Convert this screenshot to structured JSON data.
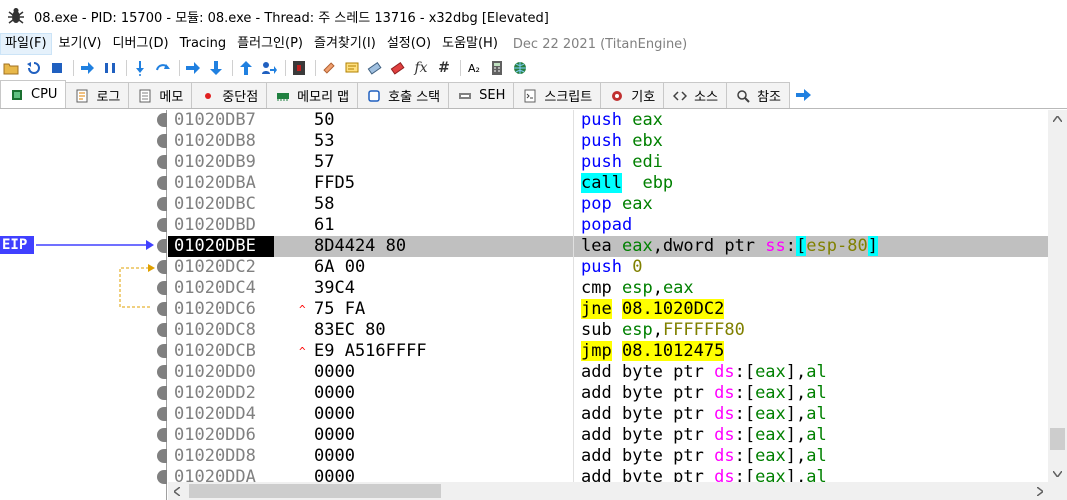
{
  "window": {
    "title": "08.exe - PID: 15700 - 모듈: 08.exe - Thread: 주 스레드 13716 - x32dbg [Elevated]"
  },
  "menu": {
    "items": [
      "파일(F)",
      "보기(V)",
      "디버그(D)",
      "Tracing",
      "플러그인(P)",
      "즐겨찾기(I)",
      "설정(O)",
      "도움말(H)"
    ],
    "date": "Dec 22 2021 (TitanEngine)"
  },
  "toolbar": {
    "icons": [
      "open-icon",
      "restart-icon",
      "stop-icon",
      "run-icon",
      "pause-icon",
      "step-into-icon",
      "step-over-icon",
      "trace-into-icon",
      "trace-over-icon",
      "execute-till-return-icon",
      "run-to-user-code-icon",
      "scylla-icon",
      "patch-icon",
      "comments-icon",
      "labels-icon",
      "bookmarks-icon",
      "functions-icon",
      "variables-icon",
      "strings-icon",
      "calculator-icon",
      "settings-icon"
    ],
    "fx_label": "fx",
    "hash_label": "#",
    "az_label": "A₂"
  },
  "tabs": [
    {
      "label": "CPU",
      "icon": "cpu-icon",
      "selected": true
    },
    {
      "label": "로그",
      "icon": "log-icon"
    },
    {
      "label": "메모",
      "icon": "notes-icon"
    },
    {
      "label": "중단점",
      "icon": "breakpoint-icon"
    },
    {
      "label": "메모리 맵",
      "icon": "memory-map-icon"
    },
    {
      "label": "호출 스택",
      "icon": "call-stack-icon"
    },
    {
      "label": "SEH",
      "icon": "seh-icon"
    },
    {
      "label": "스크립트",
      "icon": "script-icon"
    },
    {
      "label": "기호",
      "icon": "symbols-icon"
    },
    {
      "label": "소스",
      "icon": "source-icon"
    },
    {
      "label": "참조",
      "icon": "references-icon"
    }
  ],
  "eip_label": "EIP",
  "disasm": [
    {
      "addr": "01020DB7",
      "bytes": "50",
      "mnemonic": "push",
      "mtype": "push",
      "ops": [
        {
          "t": "eax",
          "c": "reg"
        }
      ]
    },
    {
      "addr": "01020DB8",
      "bytes": "53",
      "mnemonic": "push",
      "mtype": "push",
      "ops": [
        {
          "t": "ebx",
          "c": "reg"
        }
      ]
    },
    {
      "addr": "01020DB9",
      "bytes": "57",
      "mnemonic": "push",
      "mtype": "push",
      "ops": [
        {
          "t": "edi",
          "c": "reg"
        }
      ]
    },
    {
      "addr": "01020DBA",
      "bytes": "FFD5",
      "mnemonic": "call",
      "mtype": "call",
      "ops": [
        {
          "t": " ",
          "c": "plain"
        },
        {
          "t": "ebp",
          "c": "reg"
        }
      ]
    },
    {
      "addr": "01020DBC",
      "bytes": "58",
      "mnemonic": "pop",
      "mtype": "push",
      "ops": [
        {
          "t": "eax",
          "c": "reg"
        }
      ]
    },
    {
      "addr": "01020DBD",
      "bytes": "61",
      "mnemonic": "popad",
      "mtype": "push",
      "ops": []
    },
    {
      "addr": "01020DBE",
      "bytes": "8D4424 80",
      "mnemonic": "lea",
      "mtype": "plain",
      "eip": true,
      "ops": [
        {
          "t": "eax",
          "c": "reg"
        },
        {
          "t": ",dword ptr ",
          "c": "plain"
        },
        {
          "t": "ss",
          "c": "seg"
        },
        {
          "t": ":",
          "c": "plain"
        },
        {
          "t": "[",
          "c": "brk"
        },
        {
          "t": "esp-80",
          "c": "num"
        },
        {
          "t": "]",
          "c": "brk"
        }
      ]
    },
    {
      "addr": "01020DC2",
      "bytes": "6A 00",
      "mnemonic": "push",
      "mtype": "push",
      "ops": [
        {
          "t": "0",
          "c": "num"
        }
      ]
    },
    {
      "addr": "01020DC4",
      "bytes": "39C4",
      "mnemonic": "cmp",
      "mtype": "plain",
      "ops": [
        {
          "t": "esp",
          "c": "reg"
        },
        {
          "t": ",",
          "c": "plain"
        },
        {
          "t": "eax",
          "c": "reg"
        }
      ]
    },
    {
      "addr": "01020DC6",
      "bytes": "75 FA",
      "jmark": "^",
      "mnemonic": "jne",
      "mtype": "jcc",
      "ops": [
        {
          "t": "08.1020DC2",
          "c": "addr"
        }
      ]
    },
    {
      "addr": "01020DC8",
      "bytes": "83EC 80",
      "mnemonic": "sub",
      "mtype": "plain",
      "ops": [
        {
          "t": "esp",
          "c": "reg"
        },
        {
          "t": ",",
          "c": "plain"
        },
        {
          "t": "FFFFFF80",
          "c": "num"
        }
      ]
    },
    {
      "addr": "01020DCB",
      "bytes": "E9 A516FFFF",
      "jmark": "^",
      "mnemonic": "jmp",
      "mtype": "jcc",
      "ops": [
        {
          "t": "08.1012475",
          "c": "addr"
        }
      ]
    },
    {
      "addr": "01020DD0",
      "bytes": "0000",
      "mnemonic": "add",
      "mtype": "plain",
      "ops": [
        {
          "t": "byte ptr ",
          "c": "plain"
        },
        {
          "t": "ds",
          "c": "seg"
        },
        {
          "t": ":[",
          "c": "plain"
        },
        {
          "t": "eax",
          "c": "reg"
        },
        {
          "t": "],",
          "c": "plain"
        },
        {
          "t": "al",
          "c": "reg"
        }
      ]
    },
    {
      "addr": "01020DD2",
      "bytes": "0000",
      "mnemonic": "add",
      "mtype": "plain",
      "ops": [
        {
          "t": "byte ptr ",
          "c": "plain"
        },
        {
          "t": "ds",
          "c": "seg"
        },
        {
          "t": ":[",
          "c": "plain"
        },
        {
          "t": "eax",
          "c": "reg"
        },
        {
          "t": "],",
          "c": "plain"
        },
        {
          "t": "al",
          "c": "reg"
        }
      ]
    },
    {
      "addr": "01020DD4",
      "bytes": "0000",
      "mnemonic": "add",
      "mtype": "plain",
      "ops": [
        {
          "t": "byte ptr ",
          "c": "plain"
        },
        {
          "t": "ds",
          "c": "seg"
        },
        {
          "t": ":[",
          "c": "plain"
        },
        {
          "t": "eax",
          "c": "reg"
        },
        {
          "t": "],",
          "c": "plain"
        },
        {
          "t": "al",
          "c": "reg"
        }
      ]
    },
    {
      "addr": "01020DD6",
      "bytes": "0000",
      "mnemonic": "add",
      "mtype": "plain",
      "ops": [
        {
          "t": "byte ptr ",
          "c": "plain"
        },
        {
          "t": "ds",
          "c": "seg"
        },
        {
          "t": ":[",
          "c": "plain"
        },
        {
          "t": "eax",
          "c": "reg"
        },
        {
          "t": "],",
          "c": "plain"
        },
        {
          "t": "al",
          "c": "reg"
        }
      ]
    },
    {
      "addr": "01020DD8",
      "bytes": "0000",
      "mnemonic": "add",
      "mtype": "plain",
      "ops": [
        {
          "t": "byte ptr ",
          "c": "plain"
        },
        {
          "t": "ds",
          "c": "seg"
        },
        {
          "t": ":[",
          "c": "plain"
        },
        {
          "t": "eax",
          "c": "reg"
        },
        {
          "t": "],",
          "c": "plain"
        },
        {
          "t": "al",
          "c": "reg"
        }
      ]
    },
    {
      "addr": "01020DDA",
      "bytes": "0000",
      "mnemonic": "add",
      "mtype": "plain",
      "ops": [
        {
          "t": "byte ptr ",
          "c": "plain"
        },
        {
          "t": "ds",
          "c": "seg"
        },
        {
          "t": ":[",
          "c": "plain"
        },
        {
          "t": "eax",
          "c": "reg"
        },
        {
          "t": "],",
          "c": "plain"
        },
        {
          "t": "al",
          "c": "reg"
        }
      ]
    }
  ]
}
